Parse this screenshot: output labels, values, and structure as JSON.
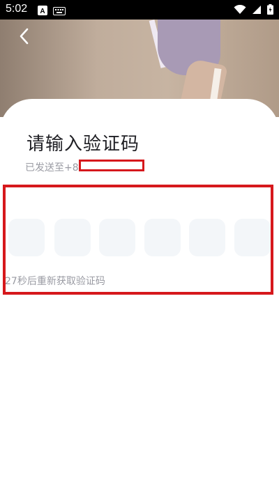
{
  "status_bar": {
    "time": "5:02",
    "left_icons": [
      "text-a-icon",
      "keyboard-icon"
    ],
    "right_icons": [
      "wifi-icon",
      "signal-icon",
      "battery-icon"
    ]
  },
  "header": {
    "back_icon": "chevron-left-icon"
  },
  "verification": {
    "title": "请输入验证码",
    "sent_prefix": "已发送至+86",
    "code_length": 6,
    "resend_text": "27秒后重新获取验证码"
  },
  "colors": {
    "accent_red": "#d6181c",
    "code_box_bg": "#f3f6f9",
    "muted_text": "#9a9ba3",
    "title_text": "#1f1f24"
  }
}
